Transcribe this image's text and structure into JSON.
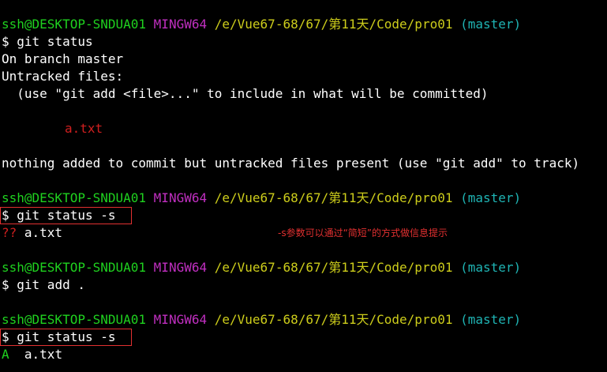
{
  "colors": {
    "background": "#000000",
    "user_host": "#1fd21f",
    "mingw": "#c02fc0",
    "path": "#cdcd1b",
    "branch": "#1fb4b4",
    "untracked_file": "#d01f1f",
    "staged": "#1fd21f",
    "highlight_box": "#e23030"
  },
  "prompt": {
    "user_host": "ssh@DESKTOP-SNDUA01",
    "system": "MINGW64",
    "path": "/e/Vue67-68/67/第11天/Code/pro01",
    "branch": "(master)",
    "symbol": "$"
  },
  "block1": {
    "command": " git status",
    "on_branch": "On branch master",
    "untracked_header": "Untracked files:",
    "hint": "  (use \"git add <file>...\" to include in what will be committed)",
    "file": "a.txt",
    "summary": "nothing added to commit but untracked files present (use \"git add\" to track)"
  },
  "block2": {
    "command": " git status -s",
    "status_code": "??",
    "file": " a.txt",
    "annotation": "-s参数可以通过“简短”的方式做信息提示"
  },
  "block3": {
    "command": " git add ."
  },
  "block4": {
    "command": " git status -s",
    "status_code": "A",
    "file": "  a.txt"
  }
}
